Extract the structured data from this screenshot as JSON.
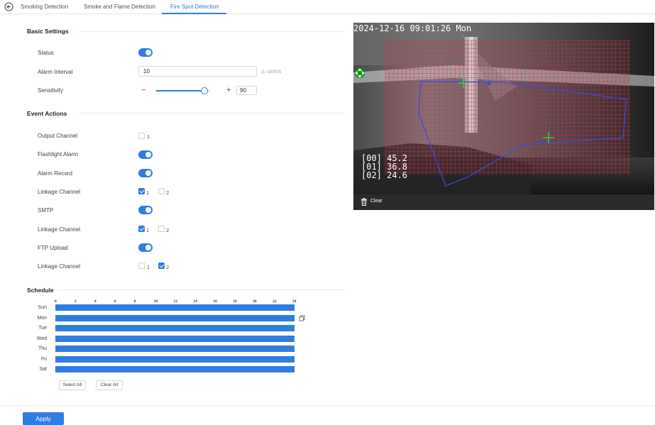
{
  "tabs": [
    {
      "label": "Smoking Detection",
      "active": false
    },
    {
      "label": "Smoke and Flame Detection",
      "active": false
    },
    {
      "label": "Fire Spot Detection",
      "active": true
    }
  ],
  "basic_settings": {
    "title": "Basic Settings",
    "status_label": "Status",
    "status_on": true,
    "alarm_interval_label": "Alarm Interval",
    "alarm_interval_value": "10",
    "alarm_interval_hint": "(1~1800)S",
    "sensitivity_label": "Sensitivity",
    "sensitivity_minus": "−",
    "sensitivity_plus": "+",
    "sensitivity_value": "90",
    "sensitivity_percent": 0.9
  },
  "event_actions": {
    "title": "Event Actions",
    "output_channel_label": "Output Channel",
    "output_channel_option": "1",
    "flashlight_alarm_label": "Flashlight Alarm",
    "alarm_record_label": "Alarm Record",
    "linkage_channel_label": "Linkage Channel",
    "smtp_label": "SMTP",
    "ftp_upload_label": "FTP Upload",
    "channel_1": "1",
    "channel_2": "2"
  },
  "schedule": {
    "title": "Schedule",
    "hours": [
      "0",
      "2",
      "4",
      "6",
      "8",
      "10",
      "12",
      "14",
      "16",
      "18",
      "20",
      "22",
      "24"
    ],
    "days": [
      "Sun",
      "Mon",
      "Tue",
      "Wed",
      "Thu",
      "Fri",
      "Sat"
    ],
    "select_all_label": "Select All",
    "clear_all_label": "Clear All"
  },
  "apply_label": "Apply",
  "preview": {
    "timestamp": "2024-12-16 09:01:26 Mon",
    "readings": [
      "[00] 45.2",
      "[01] 36.8",
      "[02] 24.6"
    ],
    "clear_label": "Clear"
  },
  "colors": {
    "accent": "#2f7de1",
    "grid_lines": "#d2324d",
    "region_line": "#3b4ce0",
    "marker": "#3ddc3d"
  }
}
